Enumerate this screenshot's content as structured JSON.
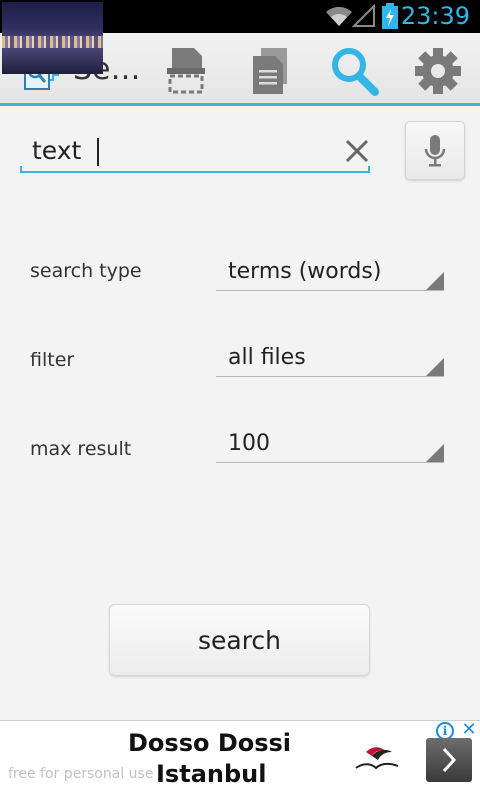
{
  "status_bar": {
    "time": "23:39"
  },
  "action_bar": {
    "title": "Se…",
    "icons": [
      "app-search-files-icon",
      "scanner-icon",
      "document-icon",
      "search-icon",
      "settings-gear-icon"
    ],
    "active_color": "#33b5e5"
  },
  "search": {
    "value": "text"
  },
  "form": {
    "rows": [
      {
        "label": "search type",
        "value": "terms (words)"
      },
      {
        "label": "filter",
        "value": "all files"
      },
      {
        "label": "max result",
        "value": "100"
      }
    ]
  },
  "search_button": {
    "label": "search"
  },
  "ad": {
    "title_line1": "Dosso Dossi",
    "title_line2": "Istanbul",
    "watermark": "free for personal use"
  }
}
